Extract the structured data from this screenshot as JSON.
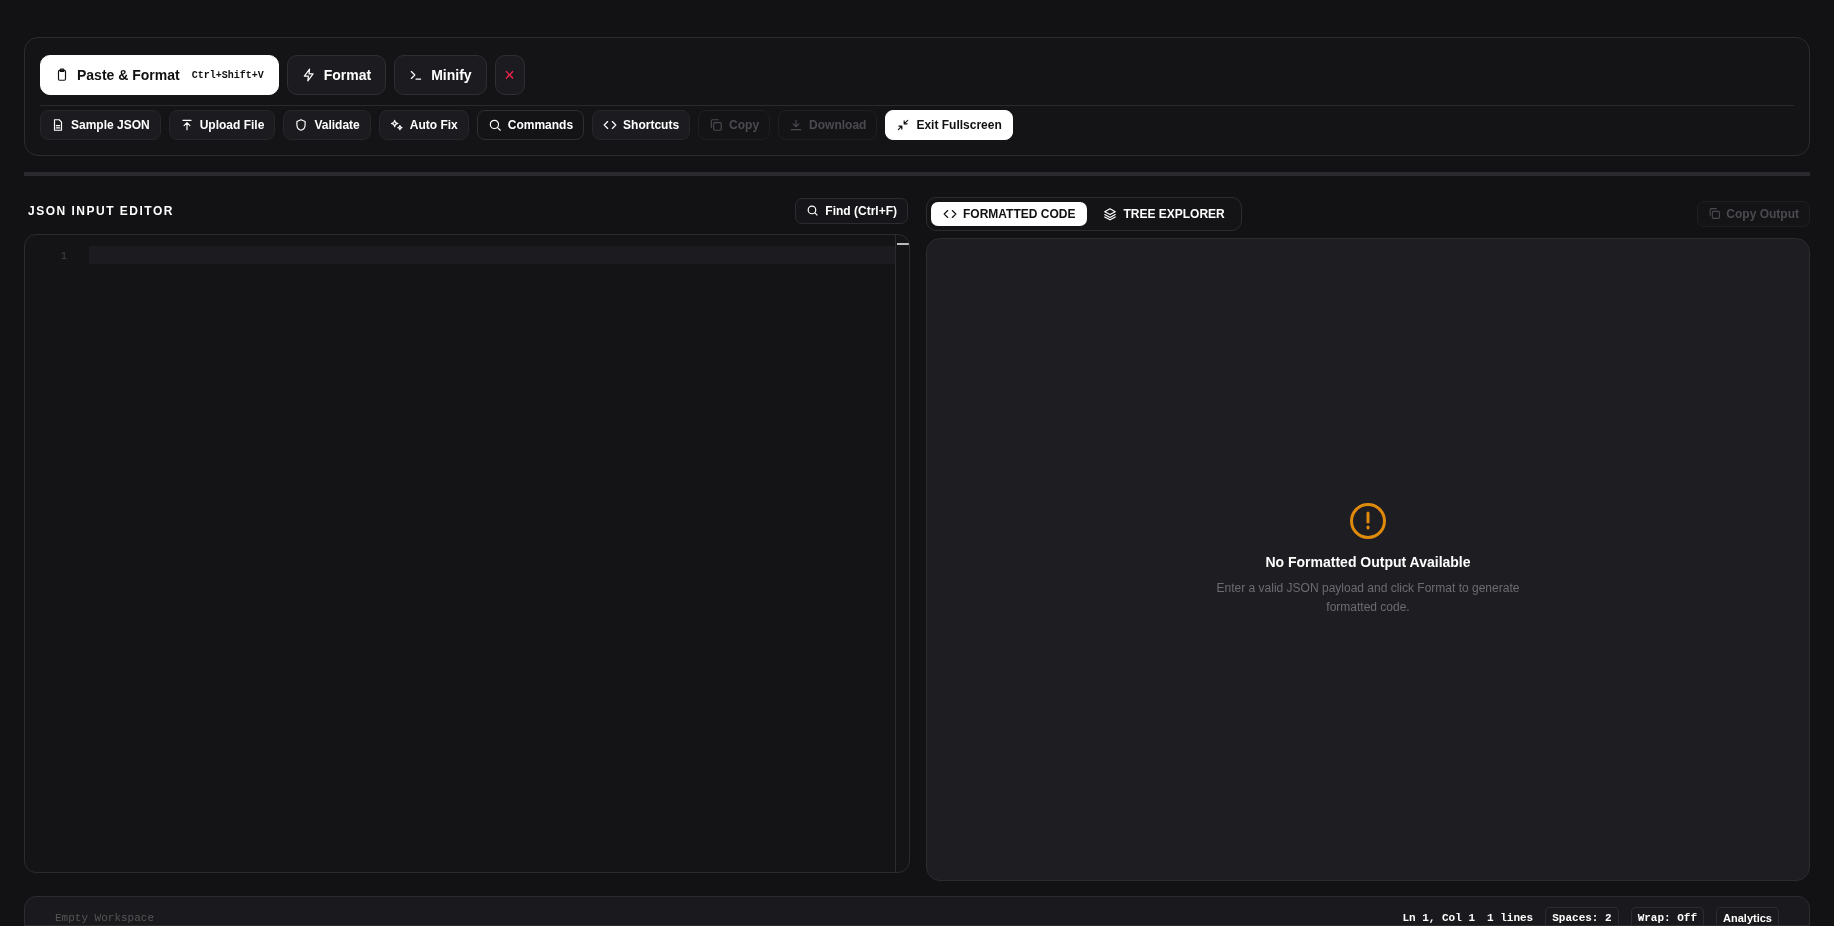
{
  "toolbar": {
    "main_actions": [
      {
        "label": "Paste & Format",
        "shortcut": "Ctrl+Shift+V",
        "kind": "primary"
      },
      {
        "label": "Format",
        "kind": "default"
      },
      {
        "label": "Minify",
        "kind": "default"
      },
      {
        "label": "×",
        "kind": "danger"
      }
    ],
    "tools": [
      {
        "label": "Sample JSON",
        "kind": "default",
        "disabled": false
      },
      {
        "label": "Upload File",
        "kind": "default",
        "disabled": false
      },
      {
        "label": "Validate",
        "kind": "default",
        "disabled": false
      },
      {
        "label": "Auto Fix",
        "kind": "default",
        "disabled": false
      },
      {
        "label": "Commands",
        "kind": "outline",
        "disabled": false
      },
      {
        "label": "Shortcuts",
        "kind": "default",
        "disabled": false
      },
      {
        "label": "Copy",
        "kind": "default",
        "disabled": true
      },
      {
        "label": "Download",
        "kind": "default",
        "disabled": true
      },
      {
        "label": "Exit Fullscreen",
        "kind": "primary",
        "disabled": false
      }
    ]
  },
  "editor": {
    "title": "JSON INPUT EDITOR",
    "find_button": "Find (Ctrl+F)",
    "line_numbers": [
      "1"
    ]
  },
  "output": {
    "tabs": [
      {
        "label": "FORMATTED CODE",
        "selected": true
      },
      {
        "label": "TREE EXPLORER",
        "selected": false
      }
    ],
    "copy_button": {
      "label": "Copy Output",
      "disabled": true
    },
    "empty_state": {
      "title": "No Formatted Output Available",
      "message": "Enter a valid JSON payload and click Format to generate formatted code."
    }
  },
  "status_bar": {
    "workspace": "Empty Workspace",
    "position": "Ln 1, Col 1",
    "lines": "1 lines",
    "spaces": "Spaces: 2",
    "wrap": "Wrap: Off",
    "analytics": "Analytics"
  }
}
